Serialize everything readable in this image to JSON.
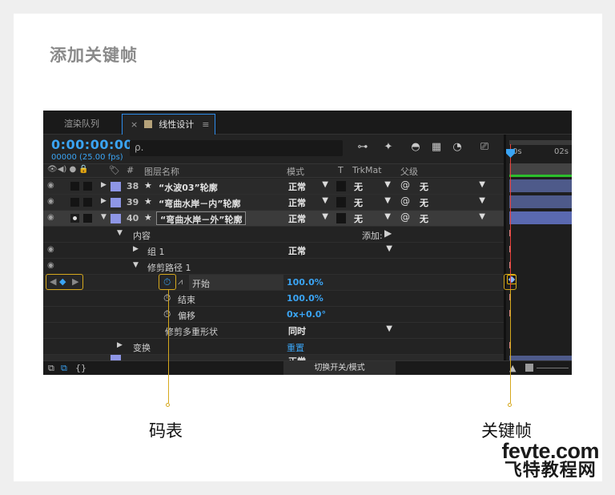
{
  "page": {
    "title": "添加关键帧"
  },
  "panel": {
    "tabs": [
      {
        "label": "渲染队列"
      },
      {
        "close": "×",
        "label": "线性设计",
        "menu": "≡"
      }
    ],
    "timecode": "0:00:00:00",
    "fps": "00000 (25.00 fps)",
    "search_icon": "ρ.",
    "columns": {
      "icons": "👁◀) ● 🔒",
      "tag": "🏷",
      "num": "#",
      "layer_name": "图层名称",
      "mode": "模式",
      "t": "T",
      "trkmat": "TrkMat",
      "parent": "父级"
    },
    "layers": [
      {
        "num": "38",
        "name": "“水波03”轮廓",
        "mode": "正常",
        "trkmat": "无",
        "parent": "无"
      },
      {
        "num": "39",
        "name": "“弯曲水岸－内”轮廓",
        "mode": "正常",
        "trkmat": "无",
        "parent": "无"
      },
      {
        "num": "40",
        "name": "“弯曲水岸－外”轮廓",
        "mode": "正常",
        "trkmat": "无",
        "parent": "无"
      }
    ],
    "contents": {
      "label": "内容",
      "add_label": "添加:",
      "group": {
        "label": "组 1",
        "mode": "正常"
      },
      "trim": {
        "label": "修剪路径 1"
      },
      "start": {
        "label": "开始",
        "value": "100.0%"
      },
      "end": {
        "label": "结束",
        "value": "100.0%"
      },
      "offset": {
        "label": "偏移",
        "value": "0x+0.0°"
      },
      "multi": {
        "label": "修剪多重形状",
        "value": "同时"
      },
      "transform": {
        "label": "变换",
        "reset": "重置"
      }
    },
    "timeline": {
      "tick0": "0s",
      "tick1": "02s"
    },
    "footer": {
      "switch_label": "切换开关/模式"
    },
    "cropped_row": {
      "mode": "正常"
    }
  },
  "callouts": {
    "stopwatch": "码表",
    "keyframe": "关键帧"
  },
  "watermark": {
    "en": "fevte.com",
    "cn": "飞特教程网"
  },
  "colors": {
    "accent": "#3aa4f4",
    "highlight": "#d6a81d",
    "layer_label": "#8e96e6"
  }
}
